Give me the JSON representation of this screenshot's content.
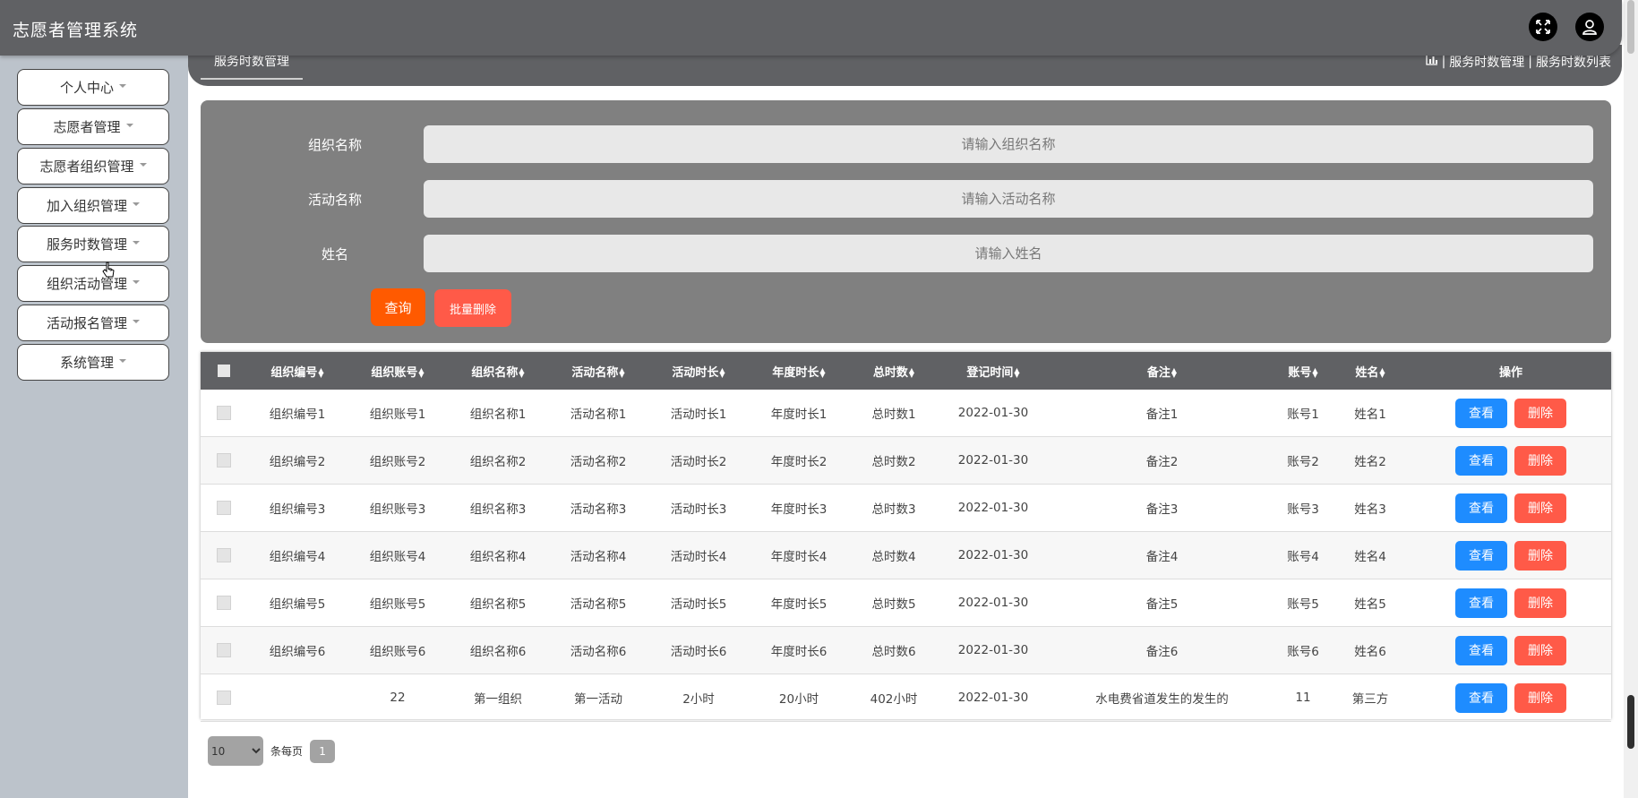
{
  "app": {
    "title": "志愿者管理系统"
  },
  "header_icons": [
    "fullscreen-icon",
    "user-icon"
  ],
  "sidebar": {
    "items": [
      {
        "label": "个人中心"
      },
      {
        "label": "志愿者管理"
      },
      {
        "label": "志愿者组织管理"
      },
      {
        "label": "加入组织管理"
      },
      {
        "label": "服务时数管理"
      },
      {
        "label": "组织活动管理"
      },
      {
        "label": "活动报名管理"
      },
      {
        "label": "系统管理"
      }
    ]
  },
  "tab": {
    "label": "服务时数管理"
  },
  "breadcrumb": {
    "separator": "|",
    "items": [
      "服务时数管理",
      "服务时数列表"
    ]
  },
  "search": {
    "org_label": "组织名称",
    "org_placeholder": "请输入组织名称",
    "activity_label": "活动名称",
    "activity_placeholder": "请输入活动名称",
    "name_label": "姓名",
    "name_placeholder": "请输入姓名",
    "query_button": "查询",
    "batch_delete_button": "批量删除"
  },
  "table": {
    "columns": [
      "组织编号",
      "组织账号",
      "组织名称",
      "活动名称",
      "活动时长",
      "年度时长",
      "总时数",
      "登记时间",
      "备注",
      "账号",
      "姓名"
    ],
    "action_header": "操作",
    "view_label": "查看",
    "delete_label": "删除",
    "rows": [
      [
        "组织编号1",
        "组织账号1",
        "组织名称1",
        "活动名称1",
        "活动时长1",
        "年度时长1",
        "总时数1",
        "2022-01-30",
        "备注1",
        "账号1",
        "姓名1"
      ],
      [
        "组织编号2",
        "组织账号2",
        "组织名称2",
        "活动名称2",
        "活动时长2",
        "年度时长2",
        "总时数2",
        "2022-01-30",
        "备注2",
        "账号2",
        "姓名2"
      ],
      [
        "组织编号3",
        "组织账号3",
        "组织名称3",
        "活动名称3",
        "活动时长3",
        "年度时长3",
        "总时数3",
        "2022-01-30",
        "备注3",
        "账号3",
        "姓名3"
      ],
      [
        "组织编号4",
        "组织账号4",
        "组织名称4",
        "活动名称4",
        "活动时长4",
        "年度时长4",
        "总时数4",
        "2022-01-30",
        "备注4",
        "账号4",
        "姓名4"
      ],
      [
        "组织编号5",
        "组织账号5",
        "组织名称5",
        "活动名称5",
        "活动时长5",
        "年度时长5",
        "总时数5",
        "2022-01-30",
        "备注5",
        "账号5",
        "姓名5"
      ],
      [
        "组织编号6",
        "组织账号6",
        "组织名称6",
        "活动名称6",
        "活动时长6",
        "年度时长6",
        "总时数6",
        "2022-01-30",
        "备注6",
        "账号6",
        "姓名6"
      ],
      [
        "",
        "22",
        "第一组织",
        "第一活动",
        "2小时",
        "20小时",
        "402小时",
        "2022-01-30",
        "水电费省道发生的发生的",
        "11",
        "第三方"
      ]
    ]
  },
  "pagination": {
    "page_size": "10",
    "per_page_label": "条每页",
    "current_page": "1"
  },
  "colors": {
    "header_bg": "#606164",
    "sidebar_bg": "#bcc3cb",
    "panel_bg": "#808080",
    "query_button": "#ff5a00",
    "batch_delete_button": "#ff5a48",
    "view_button": "#1e8cff",
    "delete_button": "#ff5a48"
  }
}
